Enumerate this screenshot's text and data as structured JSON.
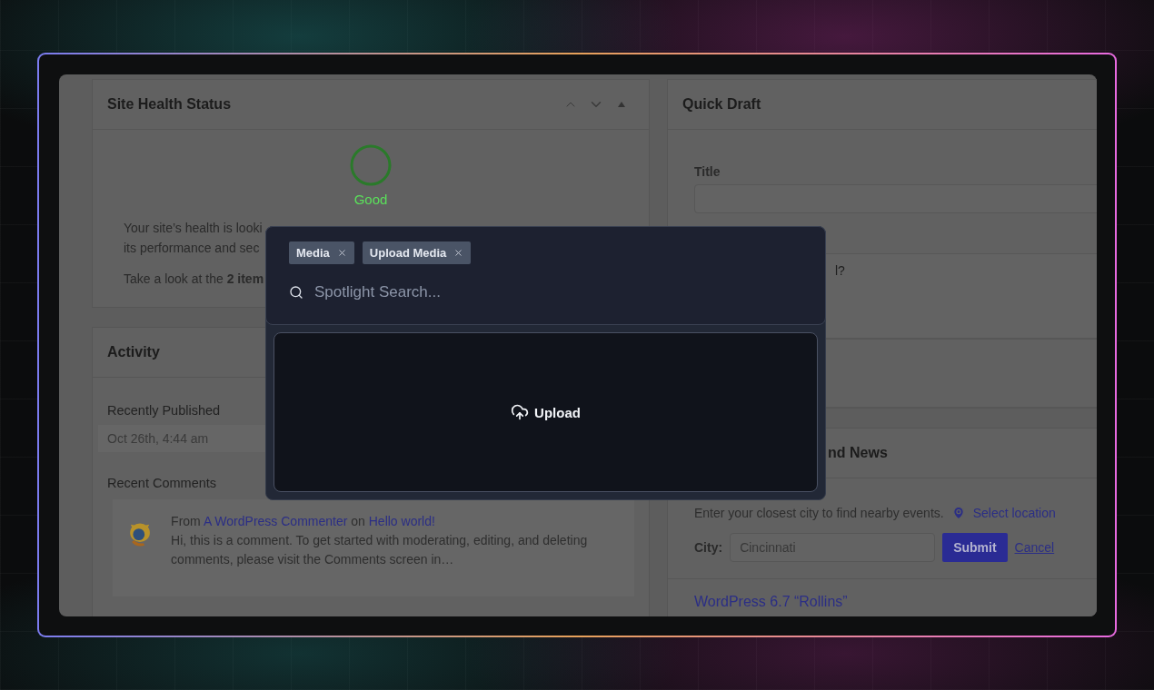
{
  "site_health": {
    "title": "Site Health Status",
    "status": "Good",
    "lines": [
      "Your site’s health is looki",
      "its performance and sec"
    ],
    "note": "Take a look at the **2 item**"
  },
  "activity": {
    "title": "Activity",
    "recently_published": {
      "heading": "Recently Published",
      "items": [
        {
          "date": "Oct 26th, 4:44 am"
        }
      ]
    },
    "recent_comments": {
      "heading": "Recent Comments",
      "items": [
        {
          "from": "From",
          "author": "A WordPress Commenter",
          "on": "on",
          "post": "Hello world!",
          "excerpt": "Hi, this is a comment. To get started with moderating, editing, and deleting comments, please visit the Comments screen in…"
        }
      ]
    }
  },
  "quick_draft": {
    "title": "Quick Draft",
    "title_label": "Title",
    "content_placeholder": "l?"
  },
  "events": {
    "title": "nd News",
    "intro": "Enter your closest city to find nearby events.",
    "select_location": "Select location",
    "city_label": "City:",
    "city_value": "Cincinnati",
    "submit": "Submit",
    "cancel": "Cancel",
    "news": [
      "WordPress 6.7 “Rollins”"
    ]
  },
  "spotlight": {
    "tags": [
      {
        "label": "Media"
      },
      {
        "label": "Upload Media"
      }
    ],
    "search": {
      "placeholder": "Spotlight Search..."
    },
    "upload": "Upload"
  }
}
